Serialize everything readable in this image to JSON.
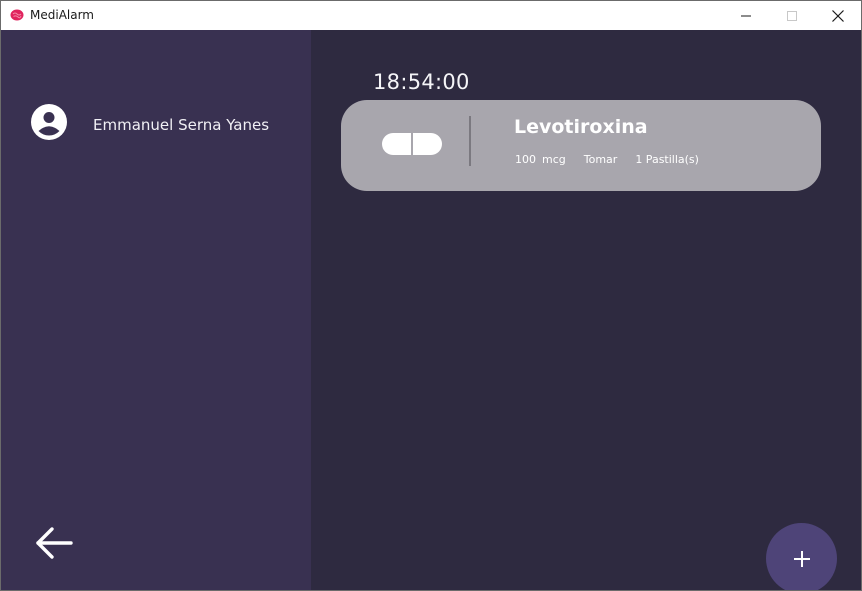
{
  "window": {
    "title": "MediAlarm",
    "icon": "brain-icon"
  },
  "sidebar": {
    "user_name": "Emmanuel Serna Yanes",
    "avatar_icon": "account-circle-icon",
    "back_icon": "arrow-left-icon"
  },
  "main": {
    "clock": "18:54:00",
    "medications": [
      {
        "name": "Levotiroxina",
        "dose_amount": "100",
        "dose_unit": "mcg",
        "action": "Tomar",
        "quantity": "1 Pastilla(s)",
        "icon": "pill-icon"
      }
    ],
    "add_icon": "plus-icon"
  },
  "colors": {
    "sidebar_bg": "#393151",
    "main_bg": "#2e2a40",
    "card_bg": "#a8a6ad",
    "fab_bg": "#4e4478",
    "brand": "#e0245e"
  }
}
